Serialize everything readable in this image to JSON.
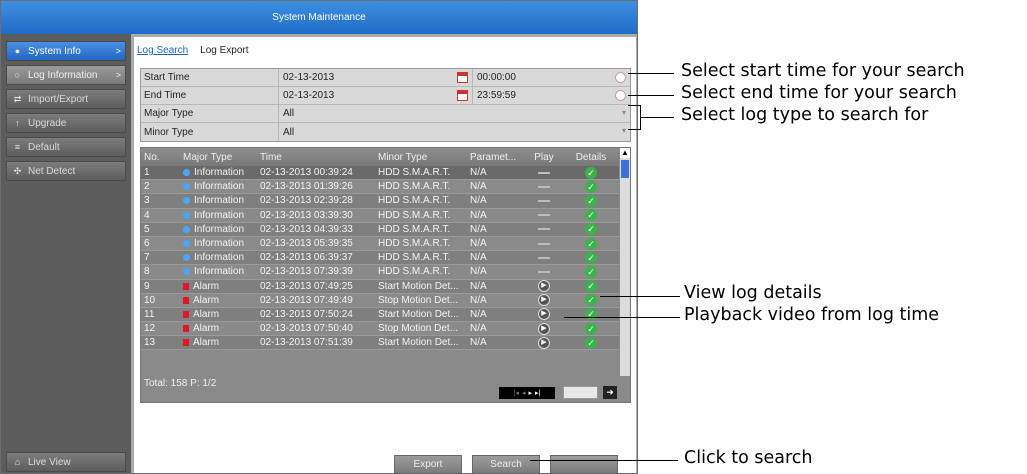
{
  "window": {
    "title": "System Maintenance"
  },
  "sidebar": {
    "items": [
      {
        "label": "System Info",
        "icon": "info-icon",
        "state": "active",
        "arrow": ">"
      },
      {
        "label": "Log Information",
        "icon": "magnifier-icon",
        "state": "hi",
        "arrow": ">"
      },
      {
        "label": "Import/Export",
        "icon": "transfer-icon",
        "state": "",
        "arrow": ""
      },
      {
        "label": "Upgrade",
        "icon": "upgrade-icon",
        "state": "",
        "arrow": ""
      },
      {
        "label": "Default",
        "icon": "default-icon",
        "state": "",
        "arrow": ""
      },
      {
        "label": "Net Detect",
        "icon": "network-icon",
        "state": "",
        "arrow": ""
      }
    ],
    "live_view": "Live View"
  },
  "tabs": {
    "log_search": "Log Search",
    "log_export": "Log Export"
  },
  "filter": {
    "start_time_label": "Start Time",
    "start_date": "02-13-2013",
    "start_clock": "00:00:00",
    "end_time_label": "End Time",
    "end_date": "02-13-2013",
    "end_clock": "23:59:59",
    "major_type_label": "Major Type",
    "major_type_value": "All",
    "minor_type_label": "Minor Type",
    "minor_type_value": "All"
  },
  "table": {
    "headers": {
      "no": "No.",
      "major": "Major Type",
      "time": "Time",
      "minor": "Minor Type",
      "param": "Paramet...",
      "play": "Play",
      "details": "Details"
    },
    "rows": [
      {
        "no": "1",
        "major": "Information",
        "kind": "info",
        "time": "02-13-2013 00:39:24",
        "minor": "HDD S.M.A.R.T.",
        "param": "N/A",
        "play": "none",
        "sel": true
      },
      {
        "no": "2",
        "major": "Information",
        "kind": "info",
        "time": "02-13-2013 01:39:26",
        "minor": "HDD S.M.A.R.T.",
        "param": "N/A",
        "play": "none"
      },
      {
        "no": "3",
        "major": "Information",
        "kind": "info",
        "time": "02-13-2013 02:39:28",
        "minor": "HDD S.M.A.R.T.",
        "param": "N/A",
        "play": "none"
      },
      {
        "no": "4",
        "major": "Information",
        "kind": "info",
        "time": "02-13-2013 03:39:30",
        "minor": "HDD S.M.A.R.T.",
        "param": "N/A",
        "play": "none"
      },
      {
        "no": "5",
        "major": "Information",
        "kind": "info",
        "time": "02-13-2013 04:39:33",
        "minor": "HDD S.M.A.R.T.",
        "param": "N/A",
        "play": "none"
      },
      {
        "no": "6",
        "major": "Information",
        "kind": "info",
        "time": "02-13-2013 05:39:35",
        "minor": "HDD S.M.A.R.T.",
        "param": "N/A",
        "play": "none"
      },
      {
        "no": "7",
        "major": "Information",
        "kind": "info",
        "time": "02-13-2013 06:39:37",
        "minor": "HDD S.M.A.R.T.",
        "param": "N/A",
        "play": "none"
      },
      {
        "no": "8",
        "major": "Information",
        "kind": "info",
        "time": "02-13-2013 07:39:39",
        "minor": "HDD S.M.A.R.T.",
        "param": "N/A",
        "play": "none"
      },
      {
        "no": "9",
        "major": "Alarm",
        "kind": "alarm",
        "time": "02-13-2013 07:49:25",
        "minor": "Start Motion Det...",
        "param": "N/A",
        "play": "button"
      },
      {
        "no": "10",
        "major": "Alarm",
        "kind": "alarm",
        "time": "02-13-2013 07:49:49",
        "minor": "Stop Motion Det...",
        "param": "N/A",
        "play": "button"
      },
      {
        "no": "11",
        "major": "Alarm",
        "kind": "alarm",
        "time": "02-13-2013 07:50:24",
        "minor": "Start Motion Det...",
        "param": "N/A",
        "play": "button"
      },
      {
        "no": "12",
        "major": "Alarm",
        "kind": "alarm",
        "time": "02-13-2013 07:50:40",
        "minor": "Stop Motion Det...",
        "param": "N/A",
        "play": "button"
      },
      {
        "no": "13",
        "major": "Alarm",
        "kind": "alarm",
        "time": "02-13-2013 07:51:39",
        "minor": "Start Motion Det...",
        "param": "N/A",
        "play": "button"
      }
    ],
    "total": "Total: 158  P: 1/2"
  },
  "buttons": {
    "export": "Export",
    "search": "Search",
    "back": ""
  },
  "callouts": {
    "start": "Select start time for your search",
    "end": "Select end time for your search",
    "type": "Select log type to search for",
    "details": "View log details",
    "playback": "Playback video from log time",
    "search": "Click to search"
  },
  "colors": {
    "title_bar": "#2a78d4",
    "info": "#4da3ff",
    "alarm": "#e0162b",
    "check": "#3ab34a"
  }
}
